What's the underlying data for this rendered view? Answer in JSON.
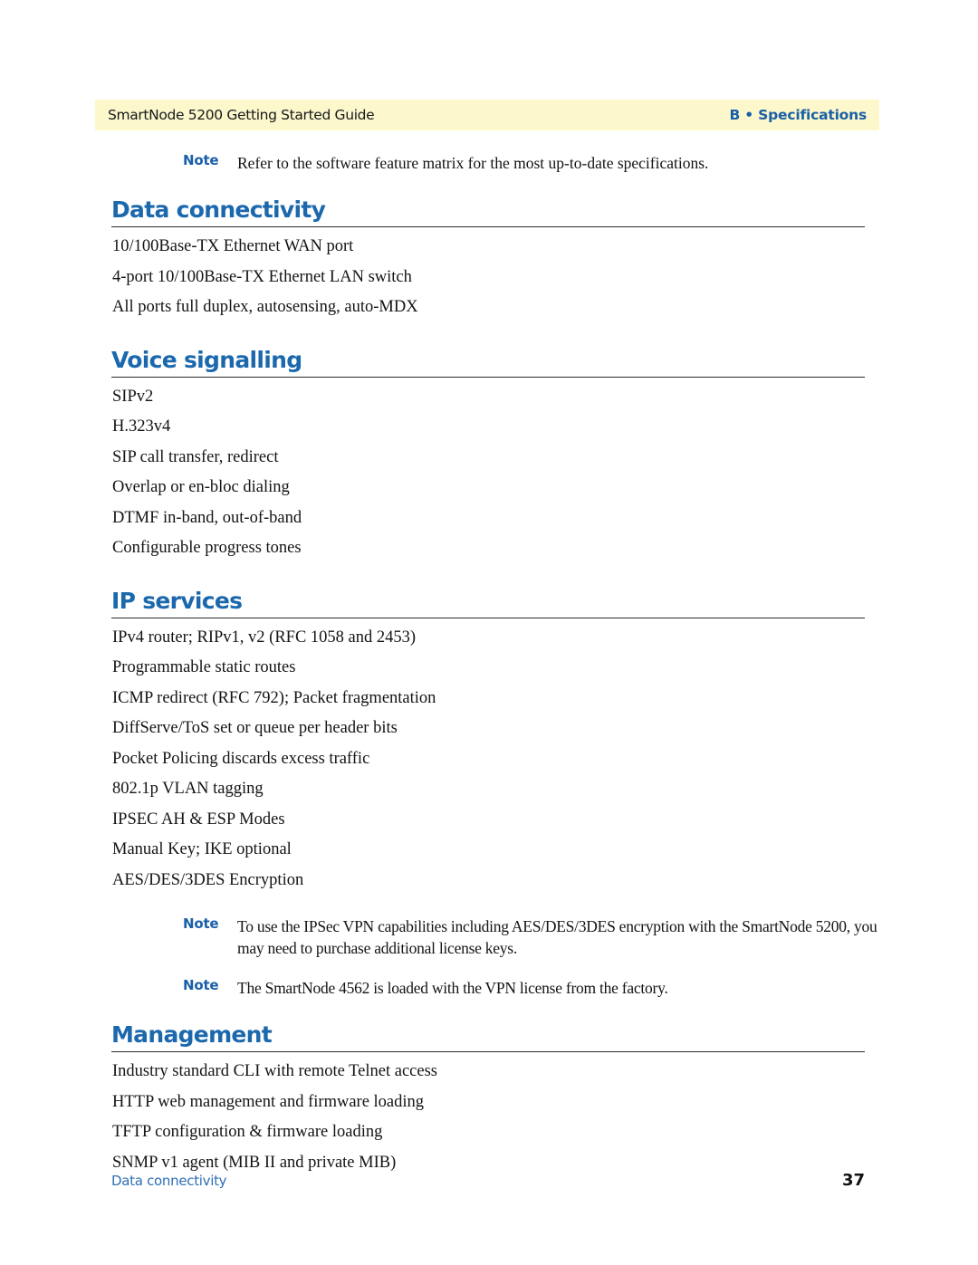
{
  "header": {
    "left_title": "SmartNode 5200 Getting Started Guide",
    "right_title": "B • Specifications",
    "band_color": "#fcf8cb",
    "accent_color": "#1a5fa8"
  },
  "intro_note": {
    "label": "Note",
    "text": "Refer to the software feature matrix for the most up-to-date specifications."
  },
  "sections": [
    {
      "title": "Data connectivity",
      "items": [
        "10/100Base-TX Ethernet WAN port",
        "4-port 10/100Base-TX Ethernet LAN switch",
        "All ports full duplex, autosensing, auto-MDX"
      ]
    },
    {
      "title": "Voice signalling",
      "items": [
        "SIPv2",
        "H.323v4",
        "SIP call transfer, redirect",
        "Overlap or en-bloc dialing",
        "DTMF in-band, out-of-band",
        "Configurable progress tones"
      ]
    },
    {
      "title": "IP services",
      "items": [
        "IPv4 router; RIPv1, v2 (RFC 1058 and 2453)",
        "Programmable static routes",
        "ICMP redirect (RFC 792); Packet fragmentation",
        "DiffServe/ToS set or queue per header bits",
        "Pocket Policing discards excess traffic",
        "802.1p VLAN tagging",
        "IPSEC AH & ESP Modes",
        "Manual Key; IKE optional",
        "AES/DES/3DES Encryption"
      ]
    },
    {
      "title": "Management",
      "items": [
        "Industry standard CLI with remote Telnet access",
        "HTTP web management and firmware loading",
        "TFTP configuration & firmware loading",
        "SNMP v1 agent (MIB II and private MIB)"
      ]
    }
  ],
  "ipsec_notes": [
    {
      "label": "Note",
      "text": "To use the IPSec VPN capabilities including AES/DES/3DES encryption with the SmartNode 5200, you may need to purchase additional license keys."
    },
    {
      "label": "Note",
      "text": "The SmartNode 4562 is loaded with the VPN license from the factory."
    }
  ],
  "footer": {
    "left_text": "Data connectivity",
    "page_number": "37",
    "link_color": "#2f6fb5"
  }
}
